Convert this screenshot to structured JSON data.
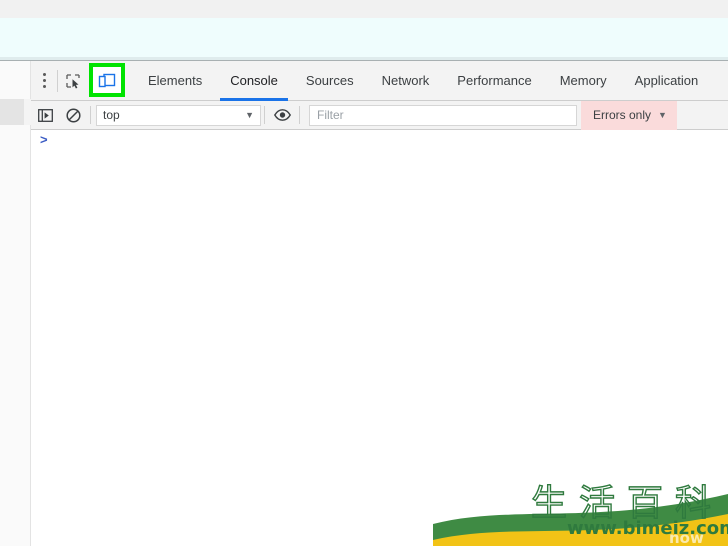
{
  "window": {
    "page_background_top_color": "#f1f1f1",
    "page_background_color": "#effdfd"
  },
  "devtools": {
    "more_options_icon": "kebab-menu-icon",
    "inspect_element_icon": "inspect-element-icon",
    "device_toolbar_icon": "toggle-device-toolbar-icon",
    "device_toolbar_highlight_color": "#00e300",
    "accent_color": "#1a73e8",
    "tabs": [
      {
        "label": "Elements",
        "active": false
      },
      {
        "label": "Console",
        "active": true
      },
      {
        "label": "Sources",
        "active": false
      },
      {
        "label": "Network",
        "active": false
      },
      {
        "label": "Performance",
        "active": false
      },
      {
        "label": "Memory",
        "active": false
      },
      {
        "label": "Application",
        "active": false
      }
    ],
    "console_toolbar": {
      "sidebar_toggle_icon": "console-sidebar-toggle-icon",
      "clear_console_icon": "clear-console-icon",
      "context_value": "top",
      "context_caret": "▼",
      "live_expression_icon": "eye-icon",
      "filter_placeholder": "Filter",
      "filter_value": "",
      "level_value": "Errors only",
      "level_caret": "▼",
      "level_background_color": "#fadbdb"
    },
    "console_body": {
      "prompt_symbol": ">",
      "prompt_color": "#3b5cc4",
      "entries": []
    }
  },
  "watermark": {
    "title_cn": "生活百科",
    "url": "www.bimeiz.com",
    "ghost_text": "now",
    "green": "#2f7a3e",
    "yellow": "#f2c316"
  }
}
